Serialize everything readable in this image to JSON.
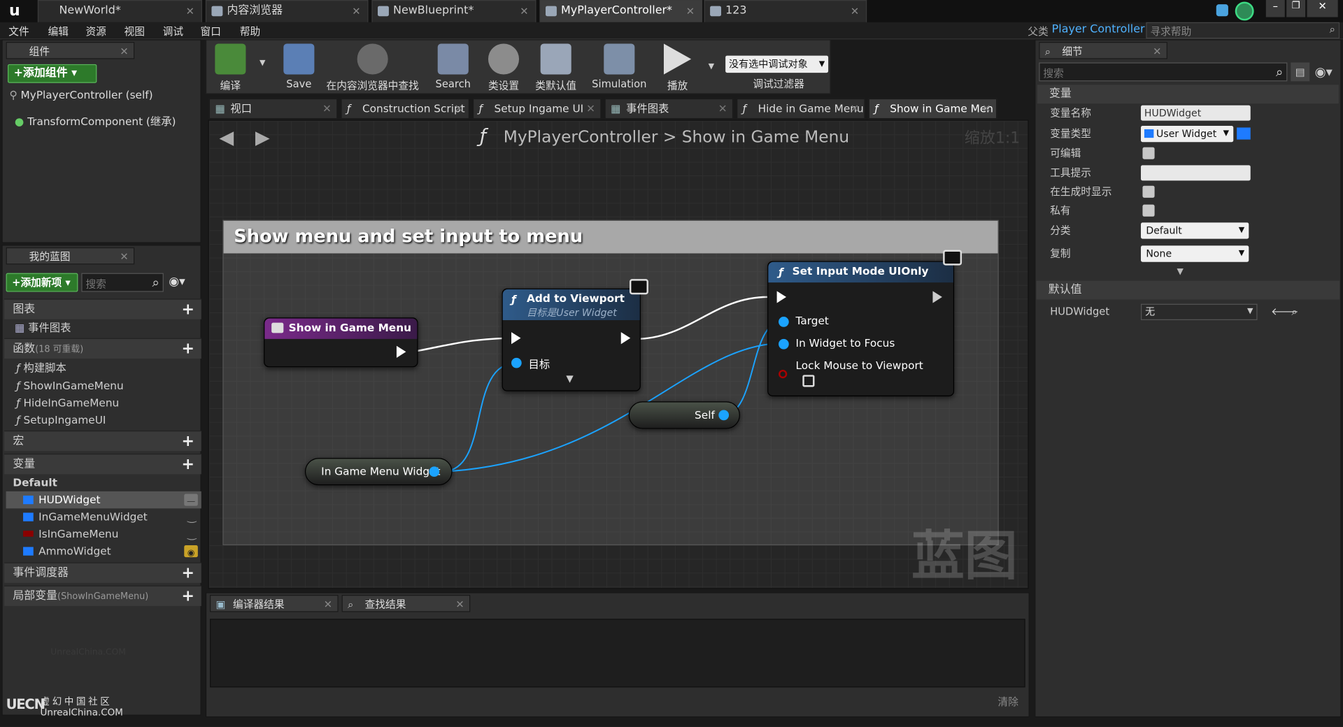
{
  "doc_tabs": [
    {
      "label": "NewWorld*"
    },
    {
      "label": "内容浏览器"
    },
    {
      "label": "NewBlueprint*"
    },
    {
      "label": "MyPlayerController*"
    },
    {
      "label": "123"
    }
  ],
  "menu": [
    "文件",
    "编辑",
    "资源",
    "视图",
    "调试",
    "窗口",
    "帮助"
  ],
  "parent_class": {
    "prefix": "父类",
    "value": "Player Controller"
  },
  "help_search_placeholder": "寻求帮助",
  "components_panel": {
    "tab": "组件",
    "add_button": "+添加组件",
    "items": [
      "MyPlayerController (self)",
      "TransformComponent (继承)"
    ]
  },
  "my_blueprint_panel": {
    "tab": "我的蓝图",
    "add_button": "+添加新项",
    "search_placeholder": "搜索",
    "graphs_label": "图表",
    "event_graph": "事件图表",
    "functions_label": "函数",
    "functions_count": "(18 可重载)",
    "functions": [
      "构建脚本",
      "ShowInGameMenu",
      "HideInGameMenu",
      "SetupIngameUI"
    ],
    "macros_label": "宏",
    "variables_label": "变量",
    "default_label": "Default",
    "variables": [
      {
        "name": "HUDWidget",
        "color": "#1e7bff"
      },
      {
        "name": "InGameMenuWidget",
        "color": "#1e7bff"
      },
      {
        "name": "IsInGameMenu",
        "color": "#8b0000"
      },
      {
        "name": "AmmoWidget",
        "color": "#1e7bff"
      }
    ],
    "dispatchers_label": "事件调度器",
    "locals_label": "局部变量",
    "locals_suffix": "(ShowInGameMenu)"
  },
  "toolbar": [
    {
      "label": "编译"
    },
    {
      "label": "Save"
    },
    {
      "label": "在内容浏览器中查找"
    },
    {
      "label": "Search"
    },
    {
      "label": "类设置"
    },
    {
      "label": "类默认值"
    },
    {
      "label": "Simulation"
    },
    {
      "label": "播放"
    }
  ],
  "debug": {
    "dropdown": "没有选中调试对象",
    "label": "调试过滤器"
  },
  "graph_tabs": [
    {
      "label": "视口"
    },
    {
      "label": "Construction Script"
    },
    {
      "label": "Setup Ingame UI"
    },
    {
      "label": "事件图表"
    },
    {
      "label": "Hide in Game Menu"
    },
    {
      "label": "Show in Game Men"
    }
  ],
  "breadcrumb": {
    "class": "MyPlayerController",
    "function": "Show in Game Menu",
    "zoom": "缩放1:1"
  },
  "comment_box": "Show menu and set input to menu",
  "nodes": {
    "entry": "Show in Game Menu",
    "add_to_viewport": {
      "title": "Add to Viewport",
      "subtitle": "目标是User Widget",
      "pin_target": "目标"
    },
    "set_input": {
      "title": "Set Input Mode UIOnly",
      "pins": [
        "Target",
        "In Widget to Focus",
        "Lock Mouse to Viewport"
      ]
    },
    "self": "Self",
    "widget_var": "In Game Menu Widget"
  },
  "watermark": "蓝图",
  "bottom_tabs": [
    {
      "label": "编译器结果"
    },
    {
      "label": "查找结果"
    }
  ],
  "clear_label": "清除",
  "footer_logo": {
    "mark": "UECN",
    "line1": "虚幻中国社区",
    "line2": "UnrealChina.COM",
    "faint": "UnrealChina.COM"
  },
  "details": {
    "tab": "细节",
    "search_placeholder": "搜索",
    "section_variables": "变量",
    "rows": [
      {
        "key": "变量名称",
        "value": "HUDWidget"
      },
      {
        "key": "变量类型",
        "value": "User Widget"
      },
      {
        "key": "可编辑",
        "value": ""
      },
      {
        "key": "工具提示",
        "value": ""
      },
      {
        "key": "在生成时显示",
        "value": ""
      },
      {
        "key": "私有",
        "value": ""
      },
      {
        "key": "分类",
        "value": "Default"
      },
      {
        "key": "复制",
        "value": "None"
      }
    ],
    "section_defaults": "默认值",
    "default_key": "HUDWidget",
    "default_value": "无"
  }
}
